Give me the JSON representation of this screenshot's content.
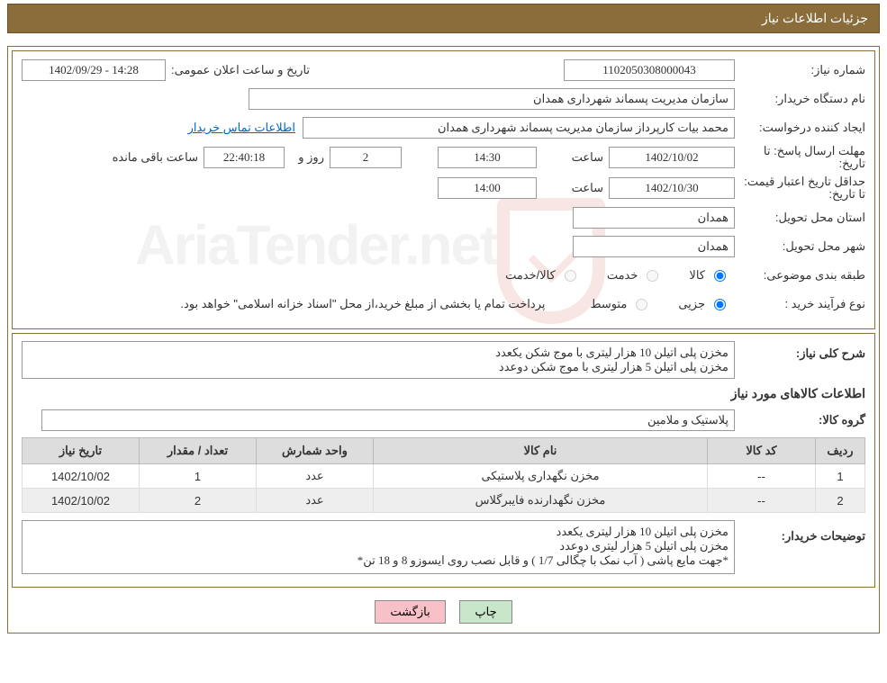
{
  "header": {
    "title": "جزئیات اطلاعات نیاز"
  },
  "info": {
    "need_number_label": "شماره نیاز:",
    "need_number": "1102050308000043",
    "announce_label": "تاریخ و ساعت اعلان عمومی:",
    "announce_value": "14:28 - 1402/09/29",
    "buyer_org_label": "نام دستگاه خریدار:",
    "buyer_org": "سازمان مدیریت پسماند شهرداری همدان",
    "requester_label": "ایجاد کننده درخواست:",
    "requester": "محمد بیات کارپرداز سازمان مدیریت پسماند شهرداری همدان",
    "contact_link": "اطلاعات تماس خریدار",
    "deadline_label": "مهلت ارسال پاسخ: تا تاریخ:",
    "deadline_date": "1402/10/02",
    "hour_label": "ساعت",
    "deadline_time": "14:30",
    "days_remaining": "2",
    "days_label": "روز و",
    "time_remaining": "22:40:18",
    "remaining_label": "ساعت باقی مانده",
    "validity_label": "حداقل تاریخ اعتبار قیمت: تا تاریخ:",
    "validity_date": "1402/10/30",
    "validity_time": "14:00",
    "province_label": "استان محل تحویل:",
    "province": "همدان",
    "city_label": "شهر محل تحویل:",
    "city": "همدان",
    "category_label": "طبقه بندی موضوعی:",
    "cat_goods": "کالا",
    "cat_service": "خدمت",
    "cat_goods_service": "کالا/خدمت",
    "purchase_type_label": "نوع فرآیند خرید :",
    "pt_minor": "جزیی",
    "pt_medium": "متوسط",
    "purchase_note": "پرداخت تمام یا بخشی از مبلغ خرید،از محل \"اسناد خزانه اسلامی\" خواهد بود."
  },
  "details": {
    "need_desc_label": "شرح کلی نیاز:",
    "need_desc": "مخزن پلی اتیلن 10 هزار لیتری با موج شکن یکعدد\nمخزن پلی اتیلن 5 هزار لیتری با موج شکن دوعدد",
    "items_header": "اطلاعات کالاهای مورد نیاز",
    "group_label": "گروه کالا:",
    "group": "پلاستیک و ملامین",
    "buyer_notes_label": "توضیحات خریدار:",
    "buyer_notes": "مخزن پلی اتیلن 10 هزار لیتری یکعدد\nمخزن پلی اتیلن 5 هزار لیتری دوعدد\n*جهت مایع پاشی ( آب نمک با چگالی 1/7 ) و قابل نصب روی ایسوزو 8 و 18 تن*"
  },
  "table": {
    "headers": {
      "row": "ردیف",
      "code": "کد کالا",
      "name": "نام کالا",
      "unit": "واحد شمارش",
      "qty": "تعداد / مقدار",
      "date": "تاریخ نیاز"
    },
    "rows": [
      {
        "row": "1",
        "code": "--",
        "name": "مخزن نگهداری پلاستیکی",
        "unit": "عدد",
        "qty": "1",
        "date": "1402/10/02"
      },
      {
        "row": "2",
        "code": "--",
        "name": "مخزن نگهدارنده فایبرگلاس",
        "unit": "عدد",
        "qty": "2",
        "date": "1402/10/02"
      }
    ]
  },
  "buttons": {
    "print": "چاپ",
    "back": "بازگشت"
  },
  "watermark": "AriaTender.net"
}
